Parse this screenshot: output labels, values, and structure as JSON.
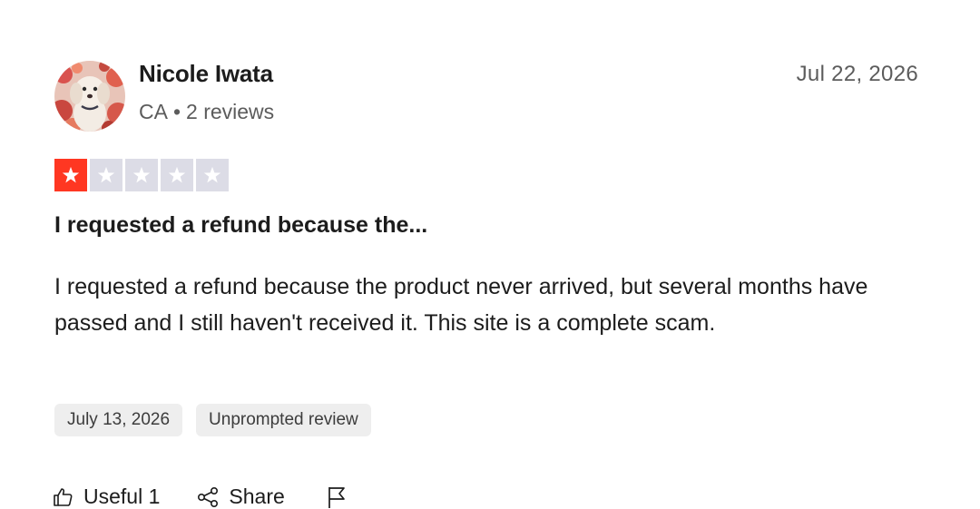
{
  "reviewer": {
    "name": "Nicole Iwata",
    "country": "CA",
    "separator": "•",
    "reviews_count": "2 reviews"
  },
  "review": {
    "date": "Jul 22, 2026",
    "rating": 1,
    "rating_max": 5,
    "title": "I requested a refund because the...",
    "body": "I requested a refund because the product never arrived, but several months have passed and I still haven't received it. This site is a complete scam."
  },
  "tags": {
    "experience_date": "July 13, 2026",
    "review_type": "Unprompted review"
  },
  "actions": {
    "useful_label": "Useful",
    "useful_count": "1",
    "share_label": "Share",
    "report_icon": "flag-icon"
  },
  "colors": {
    "star_filled": "#ff3722",
    "star_empty": "#dcdce6",
    "text_primary": "#1c1c1c",
    "text_secondary": "#5c5c5c",
    "tag_bg": "#eeeeee"
  }
}
